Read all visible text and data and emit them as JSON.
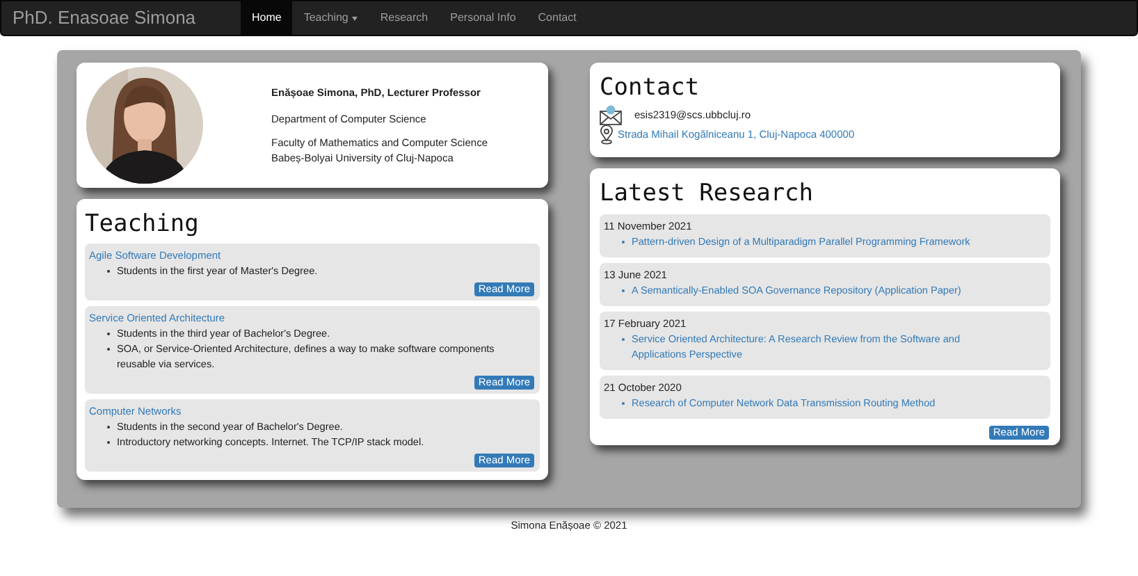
{
  "navbar": {
    "brand": "PhD. Enasoae Simona",
    "items": [
      {
        "label": "Home",
        "selected": true,
        "dropdown": false
      },
      {
        "label": "Teaching",
        "selected": false,
        "dropdown": true
      },
      {
        "label": "Research",
        "selected": false,
        "dropdown": false
      },
      {
        "label": "Personal Info",
        "selected": false,
        "dropdown": false
      },
      {
        "label": "Contact",
        "selected": false,
        "dropdown": false
      }
    ]
  },
  "profile": {
    "photo": {
      "kind": "picture"
    },
    "name": "Enășoae Simona, PhD, Lecturer Professor",
    "department": "Department of Computer Science",
    "affiliation": [
      "Faculty of Mathematics and Computer Science",
      "Babeș-Bolyai University of Cluj-Napoca"
    ]
  },
  "teaching": {
    "title": "Teaching",
    "courses": [
      {
        "name": "Agile Software Development",
        "points": [
          "Students in the first year of Master's Degree."
        ],
        "button": "Read More"
      },
      {
        "name": "Service Oriented Architecture",
        "points": [
          "Students in the third year of Bachelor's Degree.",
          "SOA, or Service-Oriented Architecture, defines a way to make software components reusable via services."
        ],
        "button": "Read More"
      },
      {
        "name": "Computer Networks",
        "points": [
          "Students in the second year of Bachelor's Degree.",
          "Introductory networking concepts. Internet. The TCP/IP stack model."
        ],
        "button": "Read More"
      }
    ]
  },
  "contact": {
    "title": "Contact",
    "email": "esis2319@scs.ubbcluj.ro",
    "address": "Strada Mihail Kogălniceanu 1, Cluj-Napoca 400000"
  },
  "research": {
    "title": "Latest Research",
    "entries": [
      {
        "date": "11 November 2021",
        "paper": "Pattern-driven Design of a Multiparadigm Parallel Programming Framework"
      },
      {
        "date": "13 June 2021",
        "paper": "A Semantically-Enabled SOA Governance Repository (Application Paper)"
      },
      {
        "date": "17 February 2021",
        "paper": "Service Oriented Architecture: A Research Review from the Software and Applications Perspective"
      },
      {
        "date": "21 October 2020",
        "paper": "Research of Computer Network Data Transmission Routing Method"
      }
    ],
    "button": "Read More"
  },
  "footer": "Simona Enășoae © 2021"
}
